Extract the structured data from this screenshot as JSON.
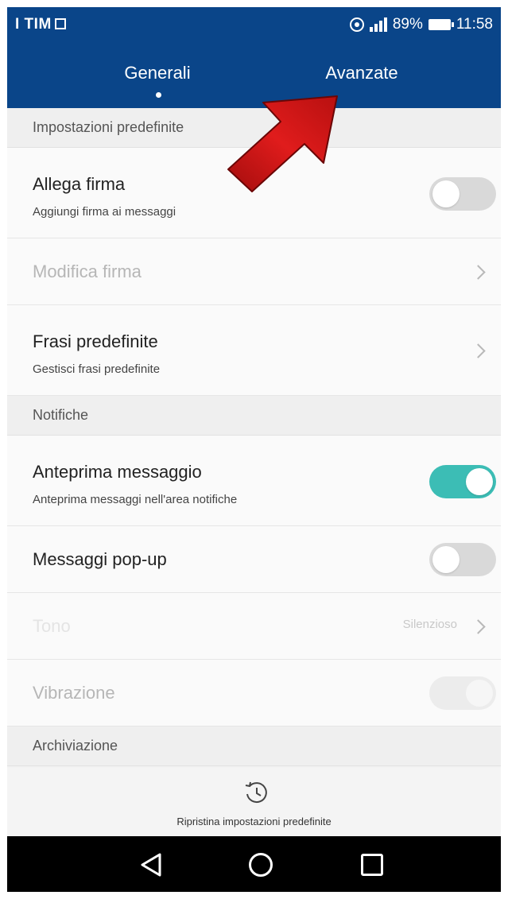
{
  "statusbar": {
    "carrier": "I TIM",
    "battery": "89%",
    "time": "11:58"
  },
  "tabs": [
    {
      "label": "Generali",
      "selected": true
    },
    {
      "label": "Avanzate",
      "selected": false
    }
  ],
  "sections": {
    "defaults": "Impostazioni predefinite",
    "notifications": "Notifiche",
    "archive": "Archiviazione"
  },
  "rows": {
    "attach_signature": {
      "title": "Allega firma",
      "subtitle": "Aggiungi firma ai messaggi",
      "toggle": false
    },
    "edit_signature": {
      "title": "Modifica firma",
      "enabled": false
    },
    "quick_phrases": {
      "title": "Frasi predefinite",
      "subtitle": "Gestisci frasi predefinite"
    },
    "message_preview": {
      "title": "Anteprima messaggio",
      "subtitle": "Anteprima messaggi nell'area notifiche",
      "toggle": true
    },
    "popup_messages": {
      "title": "Messaggi pop-up",
      "toggle": false
    },
    "ringtone": {
      "title": "Tono",
      "value": "Silenzioso",
      "enabled": false
    },
    "vibration": {
      "title": "Vibrazione",
      "toggle": true,
      "enabled": false
    }
  },
  "restore": {
    "label": "Ripristina impostazioni predefinite",
    "icon": "restore-history-icon"
  },
  "navbar": {
    "icons": [
      "back-icon",
      "home-icon",
      "recents-icon"
    ]
  },
  "colors": {
    "header": "#0a4589",
    "toggle_on": "#3cbdb5",
    "toggle_off": "#d9d9d9",
    "annotation_arrow": "#d01818"
  }
}
